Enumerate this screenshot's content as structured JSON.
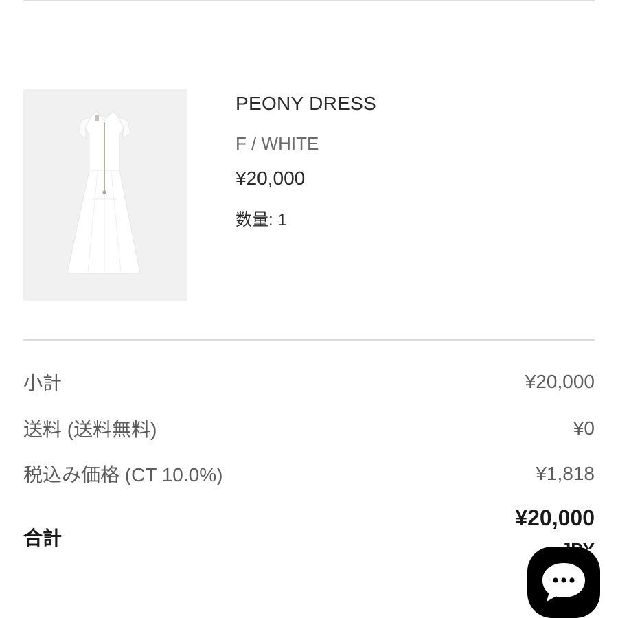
{
  "product": {
    "name": "PEONY DRESS",
    "variant": "F / WHITE",
    "price": "¥20,000",
    "quantity": "数量: 1",
    "image_icon": "white-dress-photo"
  },
  "summary": {
    "subtotal": {
      "label": "小計",
      "value": "¥20,000"
    },
    "shipping": {
      "label": "送料 (送料無料)",
      "value": "¥0"
    },
    "tax": {
      "label": "税込み価格 (CT 10.0%)",
      "value": "¥1,818"
    },
    "total": {
      "label": "合計",
      "value": "¥20,000",
      "currency": "JPY"
    }
  },
  "chat": {
    "icon": "chat-bubble-icon"
  },
  "colors": {
    "background": "#ffffff",
    "divider": "#dcdcdc",
    "text_primary": "#2a2a2a",
    "text_secondary": "#5c5c5c",
    "chat_button": "#000000"
  }
}
